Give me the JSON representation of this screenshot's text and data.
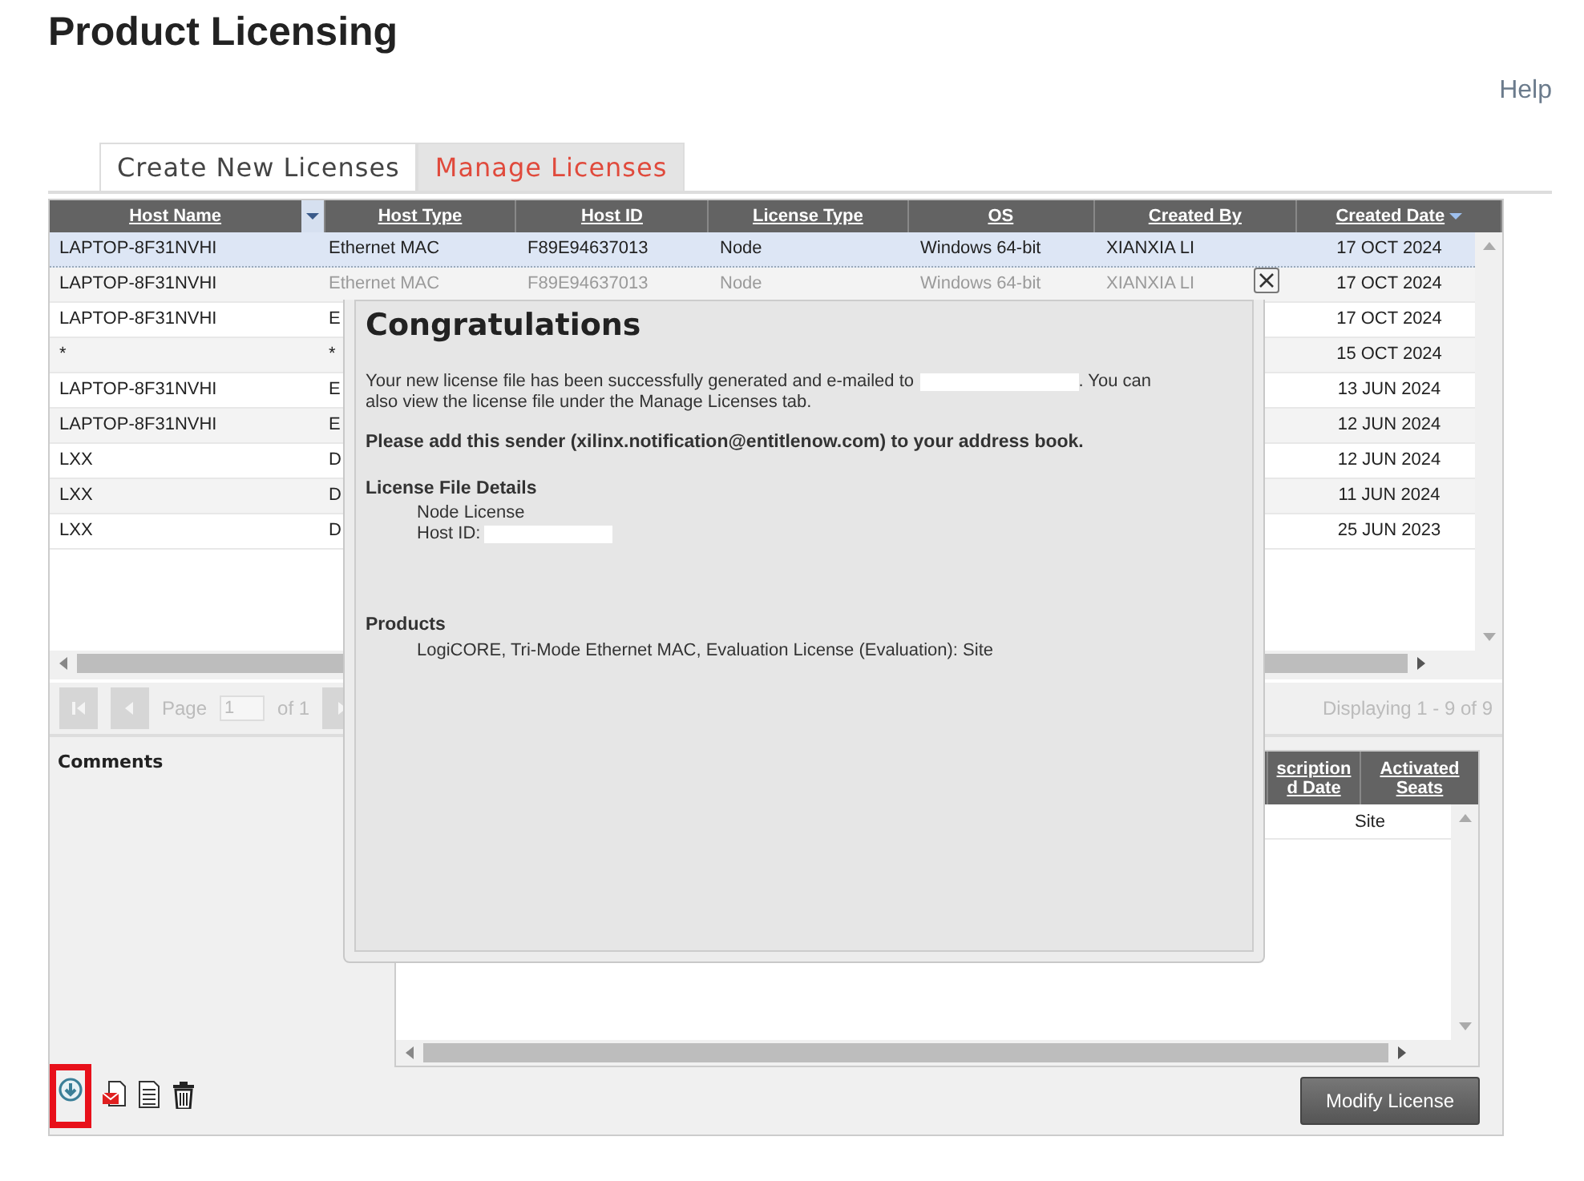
{
  "page": {
    "title": "Product Licensing",
    "help_link": "Help"
  },
  "tabs": [
    {
      "label": "Create New Licenses",
      "selected": false
    },
    {
      "label": "Manage Licenses",
      "selected": true
    }
  ],
  "grid": {
    "columns": [
      {
        "label": "Host Name",
        "sorted": false,
        "menu": true
      },
      {
        "label": "Host Type",
        "sorted": false,
        "menu": false
      },
      {
        "label": "Host ID",
        "sorted": false,
        "menu": false
      },
      {
        "label": "License Type",
        "sorted": false,
        "menu": false
      },
      {
        "label": "OS",
        "sorted": false,
        "menu": false
      },
      {
        "label": "Created By",
        "sorted": false,
        "menu": false
      },
      {
        "label": "Created Date",
        "sorted": true,
        "menu": false
      }
    ],
    "rows": [
      {
        "selected": true,
        "faded": false,
        "host_name": "LAPTOP-8F31NVHI",
        "host_type": "Ethernet MAC",
        "host_id": "F89E94637013",
        "license_type": "Node",
        "os": "Windows 64-bit",
        "created_by": "XIANXIA LI",
        "created_date": "17 OCT 2024"
      },
      {
        "selected": false,
        "faded": true,
        "host_name": "LAPTOP-8F31NVHI",
        "host_type": "Ethernet MAC",
        "host_id": "F89E94637013",
        "license_type": "Node",
        "os": "Windows 64-bit",
        "created_by": "XIANXIA LI",
        "created_date": "17 OCT 2024"
      },
      {
        "selected": false,
        "faded": false,
        "host_name": "LAPTOP-8F31NVHI",
        "host_type": "E",
        "created_date": "17 OCT 2024"
      },
      {
        "selected": false,
        "faded": false,
        "host_name": "*",
        "host_type": "*",
        "created_date": "15 OCT 2024"
      },
      {
        "selected": false,
        "faded": false,
        "host_name": "LAPTOP-8F31NVHI",
        "host_type": "E",
        "created_date": "13 JUN 2024"
      },
      {
        "selected": false,
        "faded": false,
        "host_name": "LAPTOP-8F31NVHI",
        "host_type": "E",
        "created_date": "12 JUN 2024"
      },
      {
        "selected": false,
        "faded": false,
        "host_name": "LXX",
        "host_type": "D",
        "created_date": "12 JUN 2024"
      },
      {
        "selected": false,
        "faded": false,
        "host_name": "LXX",
        "host_type": "D",
        "created_date": "11 JUN 2024"
      },
      {
        "selected": false,
        "faded": false,
        "host_name": "LXX",
        "host_type": "D",
        "created_date": "25 JUN 2023"
      }
    ]
  },
  "pager": {
    "page_label": "Page",
    "page_value": "1",
    "of_label": "of 1",
    "displaying": "Displaying 1 - 9 of 9"
  },
  "comments": {
    "label": "Comments"
  },
  "products_grid": {
    "columns": [
      {
        "lines": [
          "scription",
          "d Date"
        ]
      },
      {
        "lines": [
          "Activated",
          "Seats"
        ]
      }
    ],
    "rows": [
      {
        "activated_seats": "Site"
      }
    ]
  },
  "toolbar": [
    {
      "kind": "download",
      "highlighted": true
    },
    {
      "kind": "email",
      "highlighted": false
    },
    {
      "kind": "document",
      "highlighted": false
    },
    {
      "kind": "trash",
      "highlighted": false
    }
  ],
  "modify_button": "Modify License",
  "dialog": {
    "title": "Congratulations",
    "message_before": "Your new license file has been successfully generated and e-mailed to",
    "message_after": ". You can",
    "message_line2": "also view the license file under the Manage Licenses tab.",
    "notice": "Please add this sender (xilinx.notification@entitlenow.com) to your address book.",
    "details_heading": "License File Details",
    "details": [
      "Node License",
      "Host ID:"
    ],
    "products_heading": "Products",
    "products": [
      "LogiCORE, Tri-Mode Ethernet MAC, Evaluation License (Evaluation): Site"
    ]
  }
}
